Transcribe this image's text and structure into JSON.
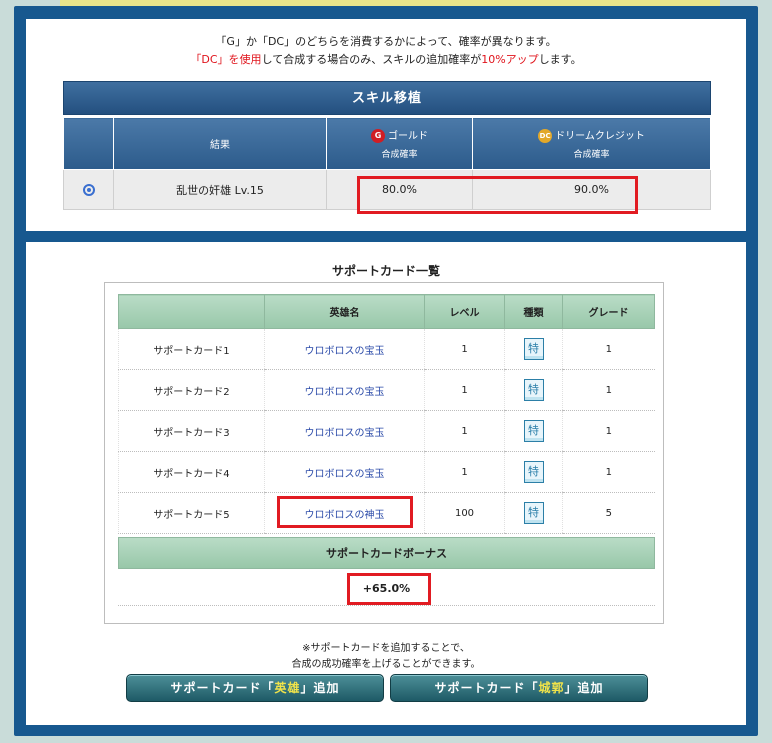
{
  "notice": {
    "line1": "「G」か「DC」のどちらを消費するかによって、確率が異なります。",
    "line2_red1": "「DC」を使用",
    "line2_mid": "して合成する場合のみ、スキルの追加確率が",
    "line2_red2": "10%アップ",
    "line2_end": "します。"
  },
  "skill": {
    "header": "スキル移植",
    "col_result": "結果",
    "gold_icon": "G",
    "gold_label": "ゴールド",
    "gold_sub": "合成確率",
    "dc_icon": "DC",
    "dc_label": "ドリームクレジット",
    "dc_sub": "合成確率",
    "row": {
      "name": "乱世の奸雄 Lv.15",
      "gold_rate": "80.0%",
      "dc_rate": "90.0%"
    }
  },
  "support": {
    "title": "サポートカード一覧",
    "columns": [
      "",
      "英雄名",
      "レベル",
      "種類",
      "グレード"
    ],
    "rows": [
      {
        "label": "サポートカード1",
        "hero": "ウロボロスの宝玉",
        "level": "1",
        "kind": "特",
        "grade": "1"
      },
      {
        "label": "サポートカード2",
        "hero": "ウロボロスの宝玉",
        "level": "1",
        "kind": "特",
        "grade": "1"
      },
      {
        "label": "サポートカード3",
        "hero": "ウロボロスの宝玉",
        "level": "1",
        "kind": "特",
        "grade": "1"
      },
      {
        "label": "サポートカード4",
        "hero": "ウロボロスの宝玉",
        "level": "1",
        "kind": "特",
        "grade": "1"
      },
      {
        "label": "サポートカード5",
        "hero": "ウロボロスの神玉",
        "level": "100",
        "kind": "特",
        "grade": "5"
      }
    ],
    "bonus_header": "サポートカードボーナス",
    "bonus_value": "+65.0%"
  },
  "footer": {
    "note1": "※サポートカードを追加することで、",
    "note2": "合成の成功確率を上げることができます。",
    "btn1_pre": "サポートカード「",
    "btn1_em": "英雄",
    "btn1_post": "」追加",
    "btn2_pre": "サポートカード「",
    "btn2_em": "城郭",
    "btn2_post": "」追加"
  },
  "colors": {
    "frame": "#17588f",
    "highlight": "#e11b22",
    "table_header_blue": "#2c5b8b",
    "table_header_green": "#98c7a9"
  }
}
